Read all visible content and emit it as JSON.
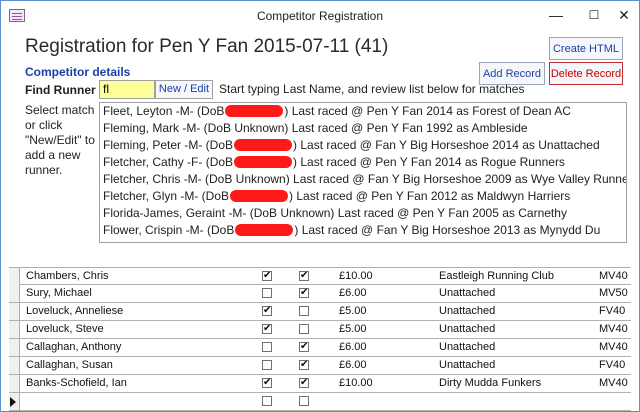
{
  "window": {
    "title": "Competitor Registration",
    "icon": "form-icon"
  },
  "form": {
    "heading": "Registration for Pen Y Fan 2015-07-11 (41)",
    "create_html_label": "Create HTML",
    "add_record_label": "Add Record",
    "delete_record_label": "Delete Record",
    "section_label": "Competitor details",
    "find_runner_label": "Find Runner",
    "find_runner_value": "fl",
    "new_edit_label": "New / Edit",
    "hint": "Start typing Last Name, and review list below for matches",
    "side_text": "Select match or click \"New/Edit\" to add a new runner.",
    "matches": [
      {
        "pre": "Fleet, Leyton -M- (DoB",
        "redacted": true,
        "post": ") Last raced @ Pen Y Fan 2014 as Forest of Dean AC"
      },
      {
        "pre": "Fleming, Mark -M- (DoB Unknown) Last raced @ Pen Y Fan 1992 as Ambleside",
        "redacted": false,
        "post": ""
      },
      {
        "pre": "Fleming, Peter -M- (DoB",
        "redacted": true,
        "post": ") Last raced @ Fan Y Big Horseshoe 2014 as Unattached"
      },
      {
        "pre": "Fletcher, Cathy -F- (DoB",
        "redacted": true,
        "post": ") Last raced @ Pen Y Fan 2014 as Rogue Runners"
      },
      {
        "pre": "Fletcher, Chris -M- (DoB Unknown) Last raced @ Fan Y Big Horseshoe 2009 as Wye Valley Runners",
        "redacted": false,
        "post": ""
      },
      {
        "pre": "Fletcher, Glyn -M- (DoB",
        "redacted": true,
        "post": ") Last raced @ Pen Y Fan 2012 as Maldwyn Harriers"
      },
      {
        "pre": "Florida-James, Geraint -M- (DoB Unknown) Last raced @ Pen Y Fan 2005 as Carnethy",
        "redacted": false,
        "post": ""
      },
      {
        "pre": "Flower, Crispin -M- (DoB",
        "redacted": true,
        "post": ") Last raced @ Fan Y Big Horseshoe 2013 as Mynydd Du"
      }
    ]
  },
  "registrations": [
    {
      "name": "Chambers, Chris",
      "check1": true,
      "check2": true,
      "fee": "£10.00",
      "club": "Eastleigh Running Club",
      "category": "MV40"
    },
    {
      "name": "Sury, Michael",
      "check1": false,
      "check2": true,
      "fee": "£6.00",
      "club": "Unattached",
      "category": "MV50"
    },
    {
      "name": "Loveluck, Anneliese",
      "check1": true,
      "check2": false,
      "fee": "£5.00",
      "club": "Unattached",
      "category": "FV40"
    },
    {
      "name": "Loveluck, Steve",
      "check1": true,
      "check2": false,
      "fee": "£5.00",
      "club": "Unattached",
      "category": "MV40"
    },
    {
      "name": "Callaghan, Anthony",
      "check1": false,
      "check2": true,
      "fee": "£6.00",
      "club": "Unattached",
      "category": "MV40"
    },
    {
      "name": "Callaghan, Susan",
      "check1": false,
      "check2": true,
      "fee": "£6.00",
      "club": "Unattached",
      "category": "FV40"
    },
    {
      "name": "Banks-Schofield, Ian",
      "check1": true,
      "check2": true,
      "fee": "£10.00",
      "club": "Dirty Mudda Funkers",
      "category": "MV40"
    }
  ]
}
